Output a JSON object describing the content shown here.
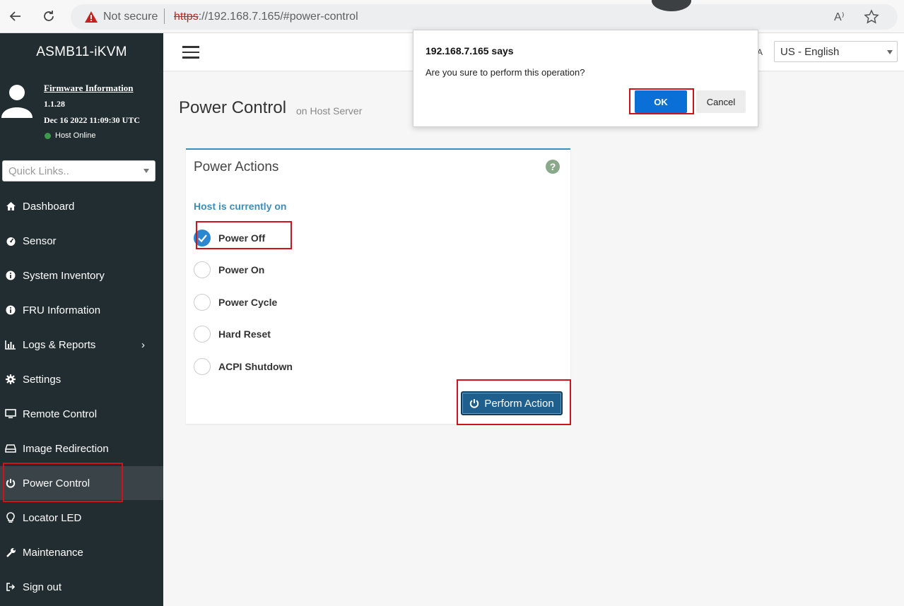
{
  "browser": {
    "security_label": "Not secure",
    "url_scheme": "https",
    "url_rest": "://192.168.7.165/#power-control",
    "read_aloud_icon": "A⁾"
  },
  "sidebar": {
    "brand": "ASMB11-iKVM",
    "firmware_title": "Firmware Information",
    "firmware_version": "1.1.28",
    "firmware_date": "Dec 16 2022 11:09:30 UTC",
    "host_status": "Host Online",
    "quick_links_placeholder": "Quick Links..",
    "items": [
      {
        "label": "Dashboard",
        "icon": "home-icon"
      },
      {
        "label": "Sensor",
        "icon": "gauge-icon"
      },
      {
        "label": "System Inventory",
        "icon": "info-icon"
      },
      {
        "label": "FRU Information",
        "icon": "info-icon"
      },
      {
        "label": "Logs & Reports",
        "icon": "bar-chart-icon",
        "chevron": "›"
      },
      {
        "label": "Settings",
        "icon": "gear-icon"
      },
      {
        "label": "Remote Control",
        "icon": "monitor-icon"
      },
      {
        "label": "Image Redirection",
        "icon": "drive-icon"
      },
      {
        "label": "Power Control",
        "icon": "power-icon"
      },
      {
        "label": "Locator LED",
        "icon": "lightbulb-icon"
      },
      {
        "label": "Maintenance",
        "icon": "wrench-icon"
      },
      {
        "label": "Sign out",
        "icon": "sign-out-icon"
      }
    ]
  },
  "header": {
    "language": "US - English",
    "user_fragment": "A"
  },
  "page": {
    "title": "Power Control",
    "subtitle": "on Host Server"
  },
  "panel": {
    "title": "Power Actions",
    "help": "?",
    "host_state": "Host is currently on",
    "options": [
      {
        "label": "Power Off",
        "checked": true
      },
      {
        "label": "Power On",
        "checked": false
      },
      {
        "label": "Power Cycle",
        "checked": false
      },
      {
        "label": "Hard Reset",
        "checked": false
      },
      {
        "label": "ACPI Shutdown",
        "checked": false
      }
    ],
    "action_label": "Perform Action"
  },
  "dialog": {
    "title": "192.168.7.165 says",
    "message": "Are you sure to perform this operation?",
    "ok_label": "OK",
    "cancel_label": "Cancel"
  },
  "colors": {
    "sidebar_bg": "#222d32",
    "accent": "#3c8dbc",
    "ok_button": "#0a6fd6",
    "highlight_box": "#d0121a"
  }
}
